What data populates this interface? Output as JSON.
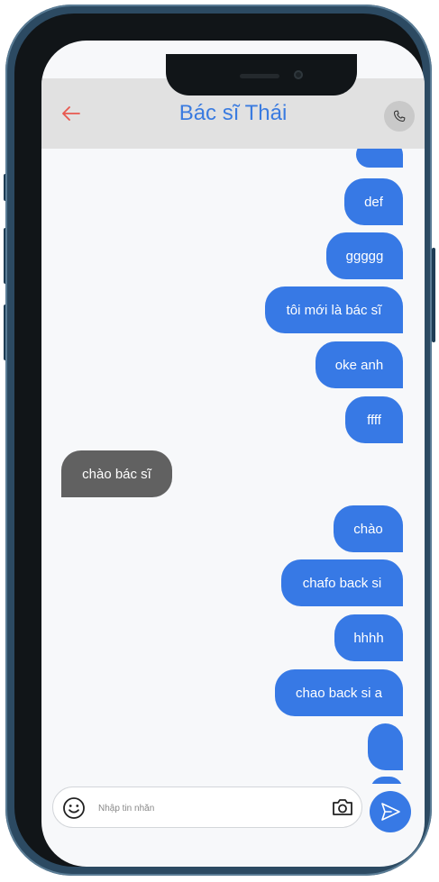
{
  "header": {
    "title": "Bác sĩ Thái",
    "back_icon": "arrow-left-icon",
    "call_icon": "phone-icon",
    "back_color": "#e8584f",
    "title_color": "#3a7be0"
  },
  "messages": [
    {
      "side": "out",
      "text": ""
    },
    {
      "side": "out",
      "text": "def"
    },
    {
      "side": "out",
      "text": "ggggg"
    },
    {
      "side": "out",
      "text": "tôi mới là bác sĩ"
    },
    {
      "side": "out",
      "text": "oke anh"
    },
    {
      "side": "out",
      "text": "ffff"
    },
    {
      "side": "in",
      "text": "chào bác sĩ"
    },
    {
      "side": "out",
      "text": "chào"
    },
    {
      "side": "out",
      "text": "chafo back si"
    },
    {
      "side": "out",
      "text": "hhhh"
    },
    {
      "side": "out",
      "text": "chao back si a"
    },
    {
      "side": "out",
      "text": ""
    },
    {
      "side": "out",
      "text": ""
    }
  ],
  "composer": {
    "placeholder": "Nhập tin nhắn",
    "value": "",
    "emoji_icon": "smiley-icon",
    "camera_icon": "camera-icon",
    "send_icon": "send-icon"
  },
  "colors": {
    "outgoing_bubble": "#3779e5",
    "incoming_bubble": "#616161",
    "header_bg": "#e1e1e1",
    "chat_bg": "#f7f8fa"
  }
}
